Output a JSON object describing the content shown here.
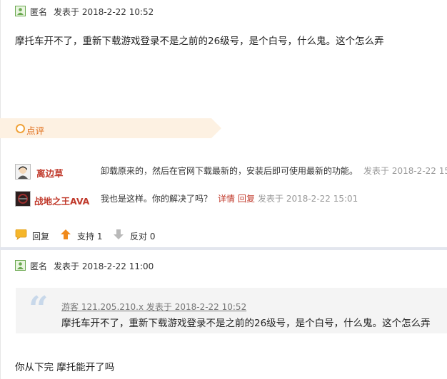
{
  "post1": {
    "author": "匿名",
    "time": "发表于 2018-2-22 10:52",
    "content": "摩托车开不了，重新下载游戏登录不是之前的26级号，是个白号，什么鬼。这个怎么弄"
  },
  "dianping": {
    "label": "点评",
    "comments": [
      {
        "name": "离边草",
        "text": "卸载原来的，然后在官网下载最新的，安装后即可使用最新的功能。",
        "time": "发表于 2018-2-22 15:",
        "detail": "",
        "reply": ""
      },
      {
        "name": "战地之王AVA",
        "text": "我也是这样。你的解决了吗？",
        "detail": "详情",
        "reply": "回复",
        "time": "发表于 2018-2-22 15:01"
      }
    ]
  },
  "actions": {
    "reply": "回复",
    "support": "支持 1",
    "oppose": "反对 0"
  },
  "post2": {
    "author": "匿名",
    "time": "发表于 2018-2-22 11:00",
    "quote_header": "游客 121.205.210.x 发表于 2018-2-22 10:52",
    "quote_text": "摩托车开不了，重新下载游戏登录不是之前的26级号，是个白号，什么鬼。这个怎么弄",
    "content": "你从下完 摩托能开了吗"
  }
}
